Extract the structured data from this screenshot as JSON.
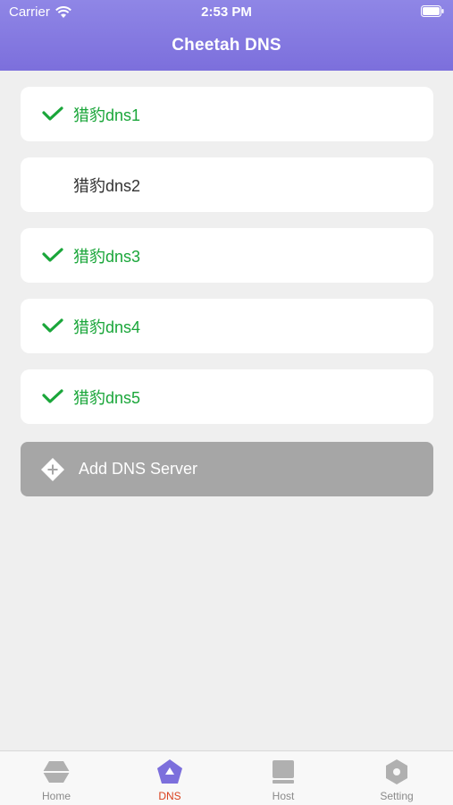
{
  "status_bar": {
    "carrier": "Carrier",
    "time": "2:53 PM"
  },
  "header": {
    "title": "Cheetah DNS"
  },
  "dns_list": [
    {
      "label": "猎豹dns1",
      "selected": true
    },
    {
      "label": "猎豹dns2",
      "selected": false
    },
    {
      "label": "猎豹dns3",
      "selected": true
    },
    {
      "label": "猎豹dns4",
      "selected": true
    },
    {
      "label": "猎豹dns5",
      "selected": true
    }
  ],
  "add_button": {
    "label": "Add DNS Server",
    "icon": "add-icon"
  },
  "tabs": [
    {
      "label": "Home",
      "icon": "home-icon",
      "active": false
    },
    {
      "label": "DNS",
      "icon": "dns-icon",
      "active": true
    },
    {
      "label": "Host",
      "icon": "host-icon",
      "active": false
    },
    {
      "label": "Setting",
      "icon": "setting-icon",
      "active": false
    }
  ],
  "colors": {
    "header": "#7c6fdc",
    "selected_text": "#1aa63a",
    "active_tab": "#d9401d",
    "active_icon": "#7c6fdc"
  }
}
